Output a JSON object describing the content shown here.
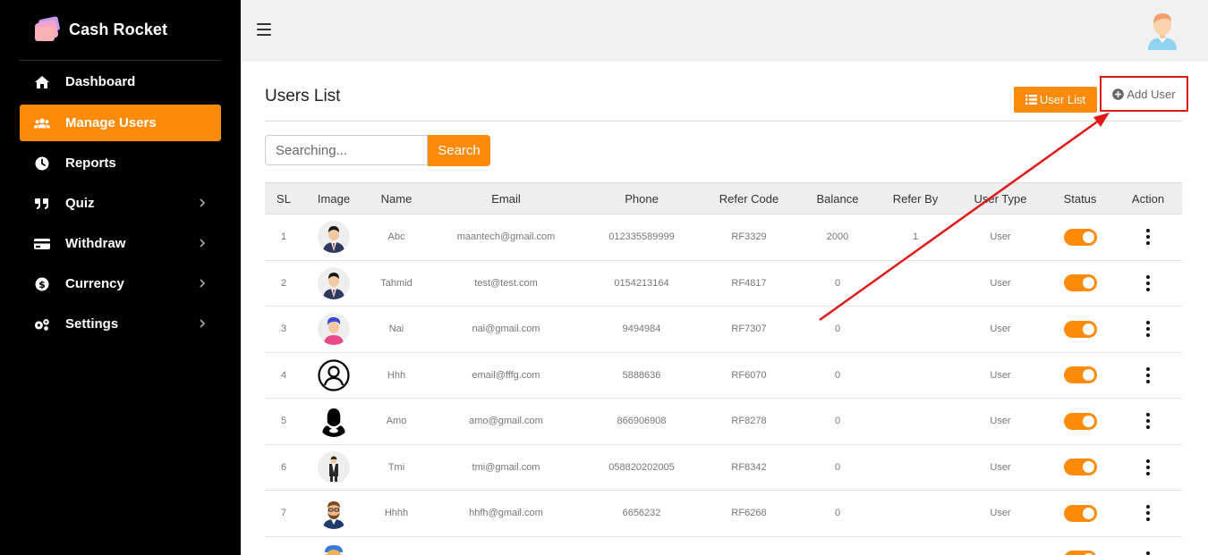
{
  "brand": {
    "name": "Cash Rocket"
  },
  "sidebar": {
    "items": [
      {
        "label": "Dashboard",
        "icon": "home-icon",
        "active": false,
        "has_submenu": false
      },
      {
        "label": "Manage Users",
        "icon": "users-icon",
        "active": true,
        "has_submenu": false
      },
      {
        "label": "Reports",
        "icon": "clock-icon",
        "active": false,
        "has_submenu": false
      },
      {
        "label": "Quiz",
        "icon": "quote-icon",
        "active": false,
        "has_submenu": true
      },
      {
        "label": "Withdraw",
        "icon": "credit-card-icon",
        "active": false,
        "has_submenu": true
      },
      {
        "label": "Currency",
        "icon": "dollar-icon",
        "active": false,
        "has_submenu": true
      },
      {
        "label": "Settings",
        "icon": "gears-icon",
        "active": false,
        "has_submenu": true
      }
    ]
  },
  "page": {
    "title": "Users List",
    "user_list_button": "User List",
    "add_user_button": "Add User"
  },
  "search": {
    "placeholder": "Searching...",
    "button": "Search"
  },
  "table": {
    "headers": [
      "SL",
      "Image",
      "Name",
      "Email",
      "Phone",
      "Refer Code",
      "Balance",
      "Refer By",
      "User Type",
      "Status",
      "Action"
    ],
    "rows": [
      {
        "sl": "1",
        "name": "Abc",
        "email": "maantech@gmail.com",
        "phone": "012335589999",
        "refer_code": "RF3329",
        "balance": "2000",
        "refer_by": "1",
        "user_type": "User",
        "status": true
      },
      {
        "sl": "2",
        "name": "Tahmid",
        "email": "test@test.com",
        "phone": "0154213164",
        "refer_code": "RF4817",
        "balance": "0",
        "refer_by": "",
        "user_type": "User",
        "status": true
      },
      {
        "sl": "3",
        "name": "Nai",
        "email": "nai@gmail.com",
        "phone": "9494984",
        "refer_code": "RF7307",
        "balance": "0",
        "refer_by": "",
        "user_type": "User",
        "status": true
      },
      {
        "sl": "4",
        "name": "Hhh",
        "email": "email@fffg.com",
        "phone": "5888636",
        "refer_code": "RF6070",
        "balance": "0",
        "refer_by": "",
        "user_type": "User",
        "status": true
      },
      {
        "sl": "5",
        "name": "Amo",
        "email": "amo@gmail.com",
        "phone": "866906908",
        "refer_code": "RF8278",
        "balance": "0",
        "refer_by": "",
        "user_type": "User",
        "status": true
      },
      {
        "sl": "6",
        "name": "Tmi",
        "email": "tmi@gmail.com",
        "phone": "058820202005",
        "refer_code": "RF8342",
        "balance": "0",
        "refer_by": "",
        "user_type": "User",
        "status": true
      },
      {
        "sl": "7",
        "name": "Hhhh",
        "email": "hhfh@gmail.com",
        "phone": "6656232",
        "refer_code": "RF6268",
        "balance": "0",
        "refer_by": "",
        "user_type": "User",
        "status": true
      },
      {
        "sl": "",
        "name": "",
        "email": "",
        "phone": "",
        "refer_code": "",
        "balance": "",
        "refer_by": "",
        "user_type": "",
        "status": true
      }
    ]
  },
  "colors": {
    "accent": "#fc8b0a",
    "sidebar_bg": "#000000",
    "annotation": "#e01818"
  }
}
